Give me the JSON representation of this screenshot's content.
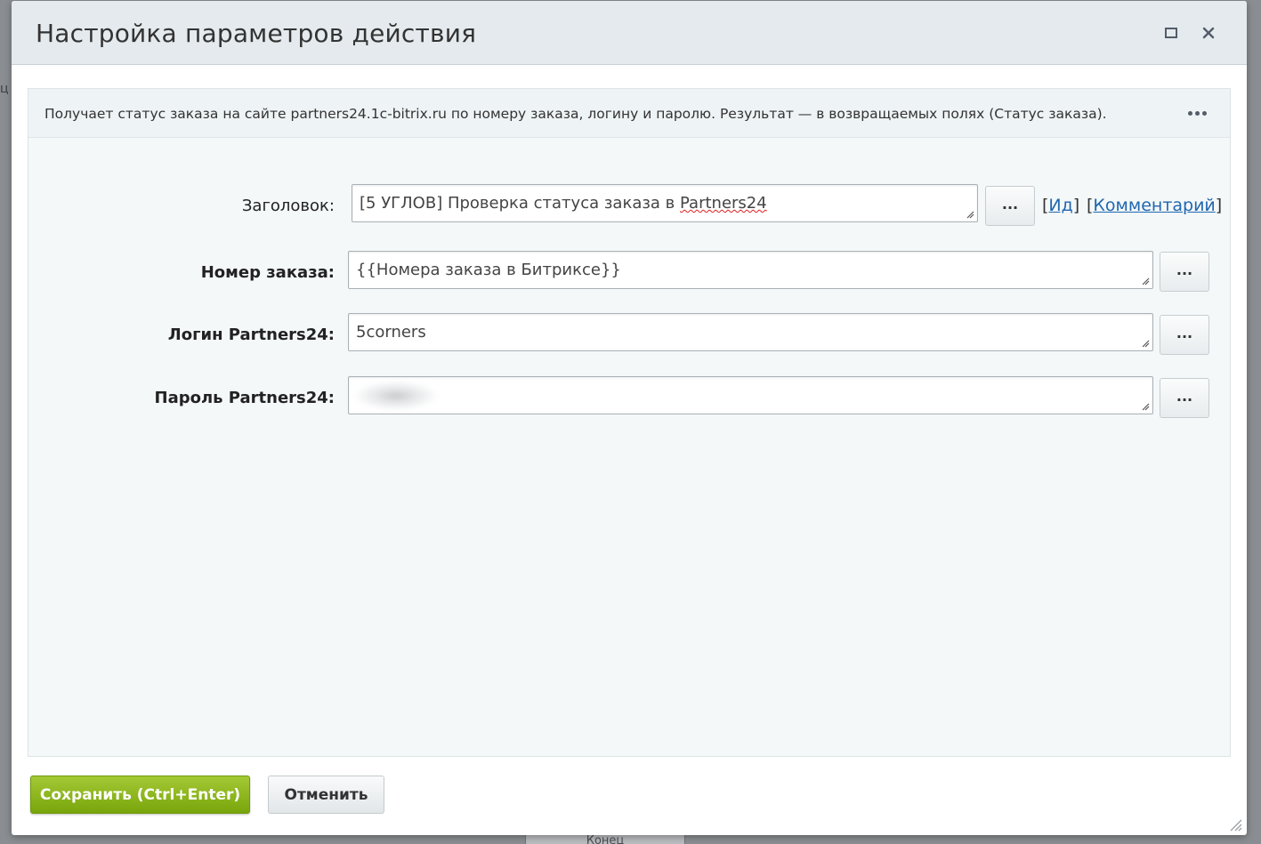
{
  "dialog": {
    "title": "Настройка параметров действия",
    "description": "Получает статус заказа на сайте partners24.1c-bitrix.ru по номеру заказа, логину и паролю. Результат — в возвращаемых полях (Статус заказа)."
  },
  "fields": {
    "title_label": "Заголовок:",
    "title_value_prefix": "[5 УГЛОВ] Проверка статуса заказа в ",
    "title_value_misspelled": "Partners24",
    "order_label": "Номер заказа:",
    "order_value": "{{Номера заказа в Битриксе}}",
    "login_label": "Логин Partners24:",
    "login_value": "5corners",
    "password_label": "Пароль Partners24:",
    "dots_label": "...",
    "id_link": "Ид",
    "comment_link": "Комментарий",
    "bracket_open": "[",
    "bracket_close": "]"
  },
  "footer": {
    "save_label": "Сохранить (Ctrl+Enter)",
    "cancel_label": "Отменить"
  },
  "background": {
    "left_char": "ц",
    "bottom_text": "Конец"
  },
  "colors": {
    "save_green": "#79a50c",
    "link_blue": "#2067b0",
    "header_bg": "#e4eaed"
  }
}
